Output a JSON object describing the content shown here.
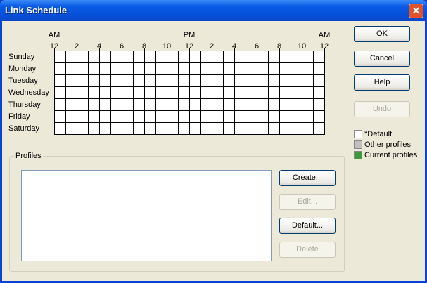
{
  "window": {
    "title": "Link Schedule"
  },
  "schedule": {
    "period_labels": [
      {
        "label": "AM",
        "hour": 0
      },
      {
        "label": "PM",
        "hour": 12
      },
      {
        "label": "AM",
        "hour": 24
      }
    ],
    "hour_labels": [
      "12",
      "2",
      "4",
      "6",
      "8",
      "10",
      "12",
      "2",
      "4",
      "6",
      "8",
      "10",
      "12"
    ],
    "days": [
      "Sunday",
      "Monday",
      "Tuesday",
      "Wednesday",
      "Thursday",
      "Friday",
      "Saturday"
    ],
    "hours_per_day": 24
  },
  "buttons": {
    "ok": "OK",
    "cancel": "Cancel",
    "help": "Help",
    "undo": "Undo"
  },
  "legend": [
    {
      "label": "*Default",
      "color": "#ffffff"
    },
    {
      "label": "Other profiles",
      "color": "#c0c0c0"
    },
    {
      "label": "Current profiles",
      "color": "#3c9a3c"
    }
  ],
  "profiles": {
    "group_label": "Profiles",
    "items": [],
    "create": "Create...",
    "edit": "Edit...",
    "default": "Default...",
    "delete": "Delete"
  }
}
